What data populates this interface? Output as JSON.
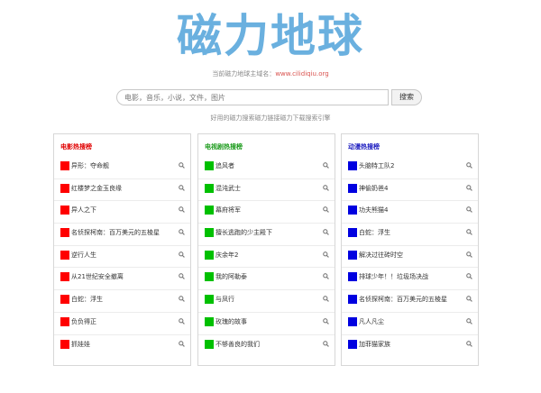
{
  "site": {
    "logo": "磁力地球",
    "domain_prefix": "当前磁力地球主域名：",
    "domain_url": "www.cilidiqiu.org",
    "search_placeholder": "电影，音乐，小说，文件，图片",
    "search_button": "搜索",
    "tagline": "好用的磁力搜索磁力链接磁力下载搜索引擎"
  },
  "colors": {
    "logo": "#6ab0df",
    "movie": "#ff0000",
    "tv": "#00c000",
    "anime": "#0000e0",
    "url": "#d9534f"
  },
  "panels": [
    {
      "title": "电影热搜榜",
      "items": [
        {
          "label": "异形：夺命舰",
          "icon": "search-icon"
        },
        {
          "label": "红楼梦之金玉良缘",
          "icon": "search-icon"
        },
        {
          "label": "异人之下",
          "icon": "search-icon"
        },
        {
          "label": "名侦探柯南：百万美元的五棱星",
          "icon": "search-icon"
        },
        {
          "label": "逆行人生",
          "icon": "search-icon"
        },
        {
          "label": "从21世纪安全撤离",
          "icon": "search-icon"
        },
        {
          "label": "白蛇：浮生",
          "icon": "search-icon"
        },
        {
          "label": "负负得正",
          "icon": "search-icon"
        },
        {
          "label": "抓娃娃",
          "icon": "search-icon"
        }
      ]
    },
    {
      "title": "电视剧热搜榜",
      "items": [
        {
          "label": "追风者",
          "icon": "search-icon"
        },
        {
          "label": "混沌武士",
          "icon": "search-icon"
        },
        {
          "label": "幕府将军",
          "icon": "search-icon"
        },
        {
          "label": "擅长逃跑的少主殿下",
          "icon": "search-icon"
        },
        {
          "label": "庆余年2",
          "icon": "search-icon"
        },
        {
          "label": "我的阿勒泰",
          "icon": "search-icon"
        },
        {
          "label": "与凤行",
          "icon": "search-icon"
        },
        {
          "label": "玫瑰的故事",
          "icon": "search-icon"
        },
        {
          "label": "不够善良的我们",
          "icon": "search-icon"
        }
      ]
    },
    {
      "title": "动漫热搜榜",
      "items": [
        {
          "label": "头脑特工队2",
          "icon": "search-icon"
        },
        {
          "label": "神偷奶爸4",
          "icon": "search-icon"
        },
        {
          "label": "功夫熊猫4",
          "icon": "search-icon"
        },
        {
          "label": "白蛇：浮生",
          "icon": "search-icon"
        },
        {
          "label": "解决过往砖时空",
          "icon": "search-icon"
        },
        {
          "label": "排球少年！！垃圾场决战",
          "icon": "search-icon"
        },
        {
          "label": "名侦探柯南：百万美元的五棱星",
          "icon": "search-icon"
        },
        {
          "label": "凡人凡尘",
          "icon": "search-icon"
        },
        {
          "label": "加菲猫家族",
          "icon": "search-icon"
        }
      ]
    }
  ]
}
